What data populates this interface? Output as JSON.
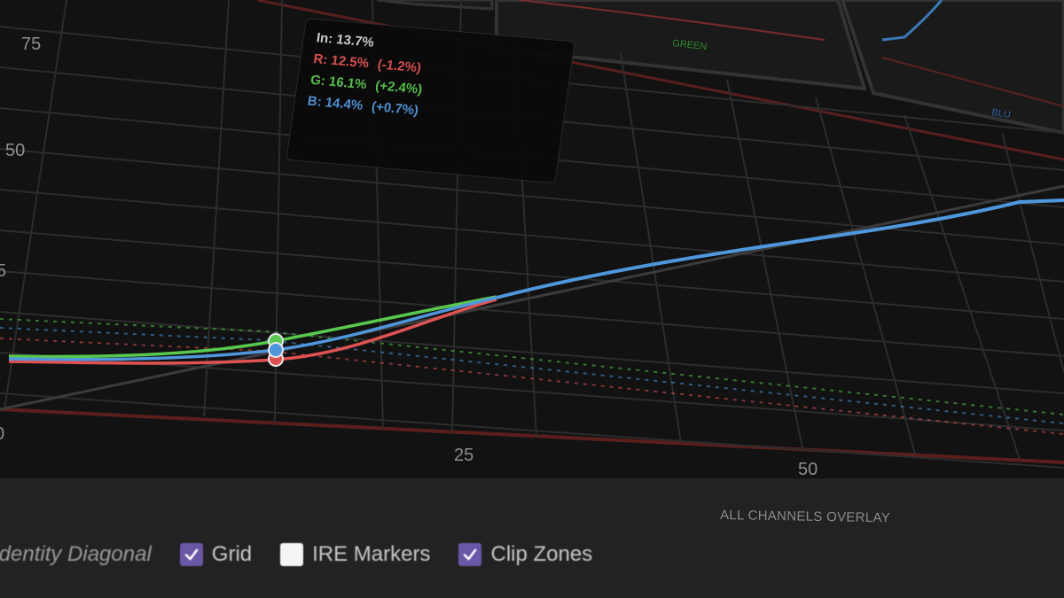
{
  "graph": {
    "y_ticks": [
      "75",
      "50",
      "5"
    ],
    "x_ticks": [
      "0",
      "25",
      "50"
    ],
    "section_label": "ALL CHANNELS OVERLAY",
    "mini_labels": [
      "GREEN",
      "BLU"
    ]
  },
  "tooltip": {
    "input": "In: 13.7%",
    "r_value": "R: 12.5%",
    "r_delta": "(-1.2%)",
    "g_value": "G: 16.1%",
    "g_delta": "(+2.4%)",
    "b_value": "B: 14.4%",
    "b_delta": "(+0.7%)"
  },
  "colors": {
    "red": "#e05252",
    "green": "#58c84e",
    "blue": "#4f97dc",
    "accent": "#6b57a7"
  },
  "toolbar": {
    "identity_label": "Identity Diagonal",
    "grid_label": "Grid",
    "grid_checked": true,
    "ire_label": "IRE Markers",
    "ire_checked": false,
    "clip_label": "Clip Zones",
    "clip_checked": true
  }
}
